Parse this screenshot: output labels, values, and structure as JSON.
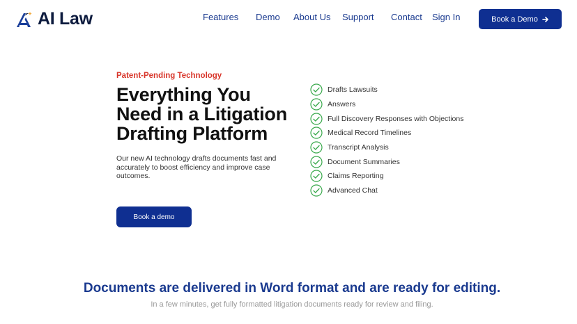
{
  "brand": {
    "name": "AI Law",
    "icon": "a-logo-icon",
    "primary_color": "#0f2f91",
    "accent_color": "#d8352a"
  },
  "nav": {
    "items": [
      {
        "label": "Features"
      },
      {
        "label": "Demo"
      },
      {
        "label": "About Us"
      },
      {
        "label": "Support"
      },
      {
        "label": "Contact"
      },
      {
        "label": "Sign In"
      }
    ],
    "cta_label": "Book a Demo",
    "cta_icon": "arrow-right-icon"
  },
  "hero": {
    "eyebrow": "Patent-Pending Technology",
    "title": "Everything You Need in a Litigation Drafting Platform",
    "description": "Our new AI technology drafts documents fast and accurately to boost efficiency and improve case outcomes.",
    "cta_label": "Book a demo"
  },
  "features": [
    "Drafts Lawsuits",
    "Answers",
    "Full Discovery Responses with Objections",
    "Medical Record Timelines",
    "Transcript Analysis",
    "Document Summaries",
    "Claims Reporting",
    "Advanced Chat"
  ],
  "section": {
    "title": "Documents are delivered in Word format and are ready for editing.",
    "subtitle": "In a few minutes, get fully formatted litigation documents ready for review and filing."
  }
}
